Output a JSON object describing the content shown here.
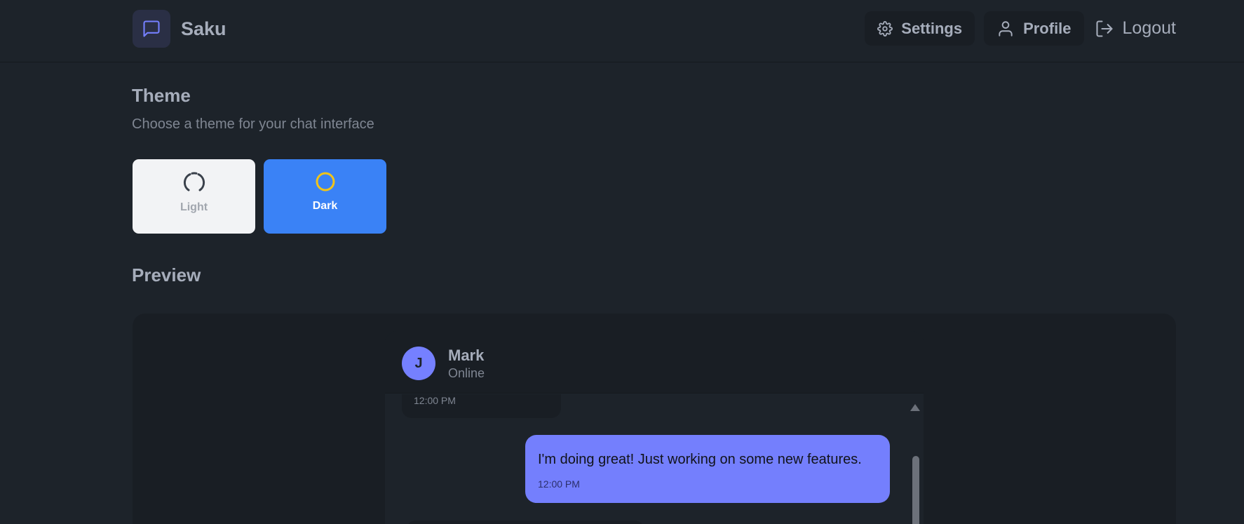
{
  "app": {
    "name": "Saku"
  },
  "nav": {
    "settings_label": "Settings",
    "profile_label": "Profile",
    "logout_label": "Logout"
  },
  "theme": {
    "title": "Theme",
    "subtitle": "Choose a theme for your chat interface",
    "options": [
      {
        "label": "Light",
        "icon": "loader-icon",
        "selected": false
      },
      {
        "label": "Dark",
        "icon": "circle-icon",
        "selected": true
      }
    ]
  },
  "preview": {
    "title": "Preview",
    "contact": {
      "initial": "J",
      "name": "Mark",
      "status": "Online"
    },
    "messages": [
      {
        "time": "12:00 PM",
        "outgoing": false
      },
      {
        "text": "I'm doing great! Just working on some new features.",
        "time": "12:00 PM",
        "outgoing": true
      }
    ]
  },
  "colors": {
    "background": "#1d232a",
    "accent": "#3a82f6",
    "bubble_outgoing": "#747ffd",
    "avatar": "#7580ff",
    "dark_icon": "#f0c419"
  }
}
